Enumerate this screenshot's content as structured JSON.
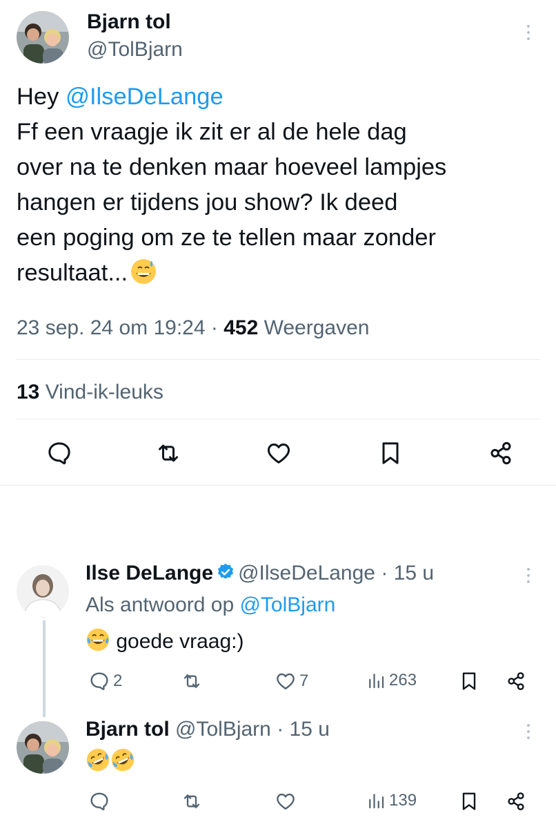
{
  "main_tweet": {
    "author_name": "Bjarn tol",
    "author_handle": "@TolBjarn",
    "text_lines": [
      {
        "prefix": "Hey ",
        "mention": "@IlseDeLange"
      },
      "Ff een vraagje ik zit er al de hele dag",
      "over na te denken maar hoeveel lampjes",
      "hangen er tijdens jou show? Ik deed",
      "een poging om ze te tellen maar zonder",
      {
        "text": "resultaat...",
        "emoji": "sweat-smile-emoji"
      }
    ],
    "date": "23 sep. 24 om 19:24",
    "separator": " · ",
    "views_count": "452",
    "views_label": " Weergaven",
    "likes_count": "13",
    "likes_label": " Vind-ik-leuks",
    "actions": [
      "reply-icon",
      "retweet-icon",
      "like-icon",
      "bookmark-icon",
      "share-icon"
    ]
  },
  "replies": [
    {
      "author_name": "Ilse DeLange",
      "verified": true,
      "author_handle": "@IlseDeLange",
      "time": " · 15 u",
      "reply_to_label": "Als antwoord op ",
      "reply_to_handle": "@TolBjarn",
      "text": " goede vraag:)",
      "emoji": "tears-of-joy-emoji",
      "stats": {
        "replies": "2",
        "retweets": "",
        "likes": "7",
        "views": "263"
      }
    },
    {
      "author_name": "Bjarn tol",
      "author_handle": "@TolBjarn",
      "time": " · 15 u",
      "emojis": [
        "rolling-laughing-emoji",
        "rolling-laughing-emoji"
      ],
      "stats": {
        "replies": "",
        "retweets": "",
        "likes": "",
        "views": "139"
      }
    }
  ],
  "colors": {
    "text": "#0f1419",
    "secondary": "#536471",
    "link": "#1d9bf0",
    "divider": "#e7eaed"
  }
}
